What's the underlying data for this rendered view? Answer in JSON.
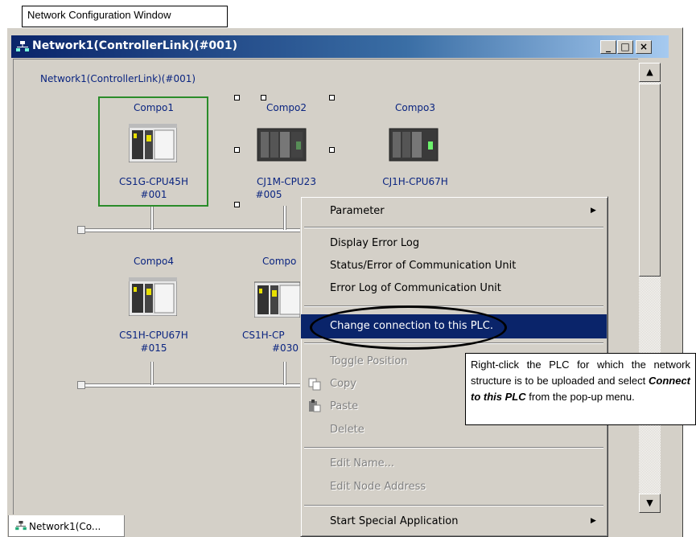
{
  "caption": "Network Configuration Window",
  "window": {
    "title": "Network1(ControllerLink)(#001)",
    "network_label": "Network1(ControllerLink)(#001)",
    "minimize": "_",
    "maximize": "□",
    "close": "×",
    "tab_label": "Network1(Co..."
  },
  "nodes": [
    {
      "name": "Compo1",
      "model": "CS1G-CPU45H",
      "address": "#001"
    },
    {
      "name": "Compo2",
      "model": "CJ1M-CPU23",
      "address": "#005"
    },
    {
      "name": "Compo3",
      "model": "CJ1H-CPU67H",
      "address": ""
    },
    {
      "name": "Compo4",
      "model": "CS1H-CPU67H",
      "address": "#015"
    },
    {
      "name": "Compo",
      "model": "CS1H-CP",
      "address": "#030"
    }
  ],
  "context_menu": {
    "items": [
      {
        "label": "Parameter",
        "submenu": true,
        "enabled": true
      },
      {
        "label": "Display Error Log",
        "enabled": true
      },
      {
        "label": "Status/Error of Communication Unit",
        "enabled": true
      },
      {
        "label": "Error Log of Communication Unit",
        "enabled": true
      },
      {
        "label": "Change connection to this PLC.",
        "enabled": true,
        "selected": true
      },
      {
        "label": "Toggle Position",
        "enabled": false
      },
      {
        "label": "Copy",
        "enabled": false,
        "icon": "copy-icon"
      },
      {
        "label": "Paste",
        "enabled": false,
        "icon": "paste-icon"
      },
      {
        "label": "Delete",
        "enabled": false
      },
      {
        "label": "Edit Name...",
        "enabled": false
      },
      {
        "label": "Edit Node Address",
        "enabled": false
      },
      {
        "label": "Start Special Application",
        "submenu": true,
        "enabled": true
      }
    ]
  },
  "callout": {
    "text_before": "Right-click the PLC for which the network structure is to be uploaded and select ",
    "emphasis": "Connect to this PLC",
    "text_after": " from the pop-up menu."
  },
  "colors": {
    "titlebar": "#0a246a",
    "menu_highlight": "#0a246a",
    "node_text": "#0a2480",
    "selection_border": "#2a8c2a"
  }
}
